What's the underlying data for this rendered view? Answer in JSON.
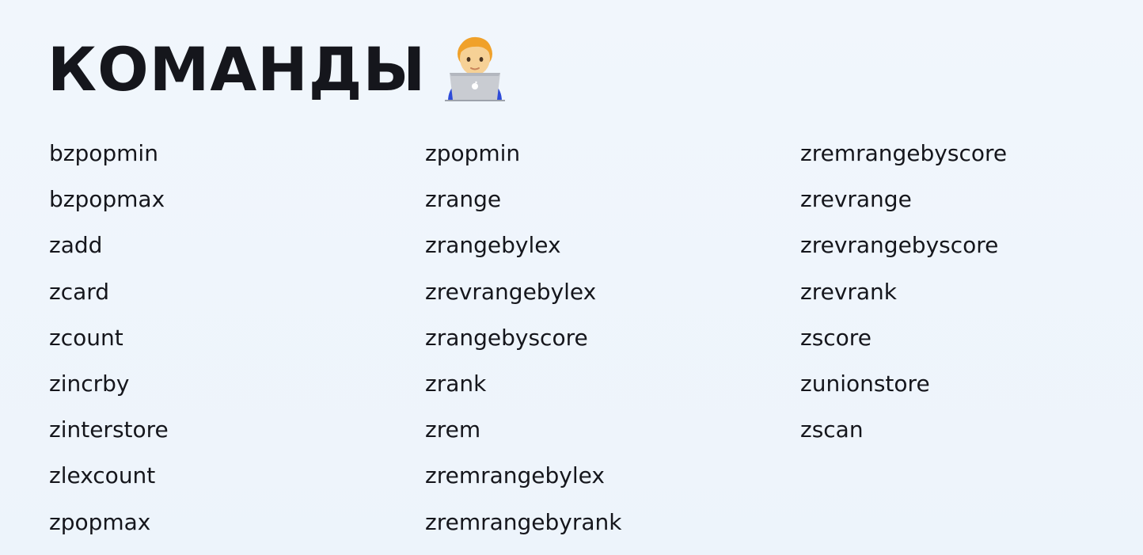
{
  "title": "КОМАНДЫ",
  "title_icon": "technologist-with-laptop-icon",
  "columns": [
    [
      "bzpopmin",
      "bzpopmax",
      "zadd",
      "zcard",
      "zcount",
      "zincrby",
      "zinterstore",
      "zlexcount",
      "zpopmax"
    ],
    [
      "zpopmin",
      "zrange",
      "zrangebylex",
      "zrevrangebylex",
      "zrangebyscore",
      "zrank",
      "zrem",
      "zremrangebylex",
      "zremrangebyrank"
    ],
    [
      "zremrangebyscore",
      "zrevrange",
      "zrevrangebyscore",
      "zrevrank",
      "zscore",
      "zunionstore",
      "zscan"
    ]
  ],
  "colors": {
    "background": "#eef5fc",
    "text": "#15161c"
  }
}
